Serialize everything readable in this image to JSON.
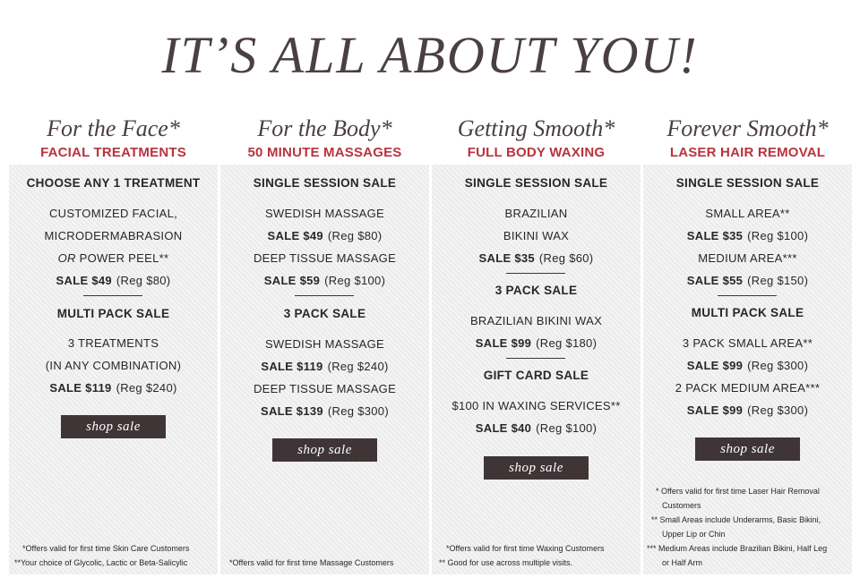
{
  "headline": "IT’S ALL ABOUT YOU!",
  "button_label": "shop sale",
  "columns": [
    {
      "title": "For the Face*",
      "subtitle": "FACIAL TREATMENTS",
      "lines": {
        "h1": "CHOOSE ANY 1 TREATMENT",
        "l1": "CUSTOMIZED FACIAL,",
        "l2": "MICRODERMABRASION",
        "or": "OR",
        "l3": " POWER PEEL**",
        "s1": "SALE $49",
        "r1": "(Reg $80)",
        "h2": "MULTI PACK SALE",
        "l4": "3 TREATMENTS",
        "l5": "(IN ANY COMBINATION)",
        "s2": "SALE $119",
        "r2": "(Reg $240)"
      },
      "notes": [
        "*Offers valid for first time Skin Care Customers",
        "**Your choice of Glycolic, Lactic or Beta-Salicylic"
      ]
    },
    {
      "title": "For the Body*",
      "subtitle": "50 MINUTE MASSAGES",
      "lines": {
        "h1": "SINGLE SESSION SALE",
        "l1": "SWEDISH MASSAGE",
        "s1": "SALE $49",
        "r1": "(Reg $80)",
        "l2": "DEEP TISSUE MASSAGE",
        "s2": "SALE $59",
        "r2": "(Reg $100)",
        "h2": "3 PACK SALE",
        "l3": "SWEDISH MASSAGE",
        "s3": "SALE $119",
        "r3": "(Reg $240)",
        "l4": "DEEP TISSUE MASSAGE",
        "s4": "SALE $139",
        "r4": "(Reg $300)"
      },
      "notes": [
        "*Offers valid for first time Massage Customers"
      ]
    },
    {
      "title": "Getting Smooth*",
      "subtitle": "FULL BODY WAXING",
      "lines": {
        "h1": "SINGLE SESSION SALE",
        "l1": "BRAZILIAN",
        "l2": "BIKINI WAX",
        "s1": "SALE $35",
        "r1": "(Reg $60)",
        "h2": "3 PACK SALE",
        "l3": "BRAZILIAN BIKINI WAX",
        "s2": "SALE $99",
        "r2": "(Reg $180)",
        "h3": "GIFT CARD SALE",
        "l4": "$100 IN WAXING SERVICES**",
        "s3": "SALE $40",
        "r3": "(Reg $100)"
      },
      "notes": [
        "*Offers valid for first time Waxing Customers",
        "** Good for use across multiple visits."
      ]
    },
    {
      "title": "Forever Smooth*",
      "subtitle": "LASER HAIR REMOVAL",
      "lines": {
        "h1": "SINGLE SESSION SALE",
        "l1": "SMALL AREA**",
        "s1": "SALE $35",
        "r1": "(Reg $100)",
        "l2": "MEDIUM AREA***",
        "s2": "SALE $55",
        "r2": "(Reg $150)",
        "h2": "MULTI PACK SALE",
        "l3": "3 PACK SMALL AREA**",
        "s3": "SALE $99",
        "r3": "(Reg $300)",
        "l4": "2 PACK MEDIUM AREA***",
        "s4": "SALE $99",
        "r4": "(Reg $300)"
      },
      "notes": [
        "* Offers valid for first time Laser Hair Removal",
        "Customers",
        "** Small Areas include Underarms, Basic Bikini,",
        "Upper Lip or Chin",
        "*** Medium Areas include Brazilian Bikini, Half Leg",
        "or Half Arm"
      ]
    }
  ],
  "colors": {
    "accent_red": "#b8343c",
    "button_bg": "#3f3537",
    "panel_bg": "#efefef",
    "headline": "#4a3f42"
  }
}
